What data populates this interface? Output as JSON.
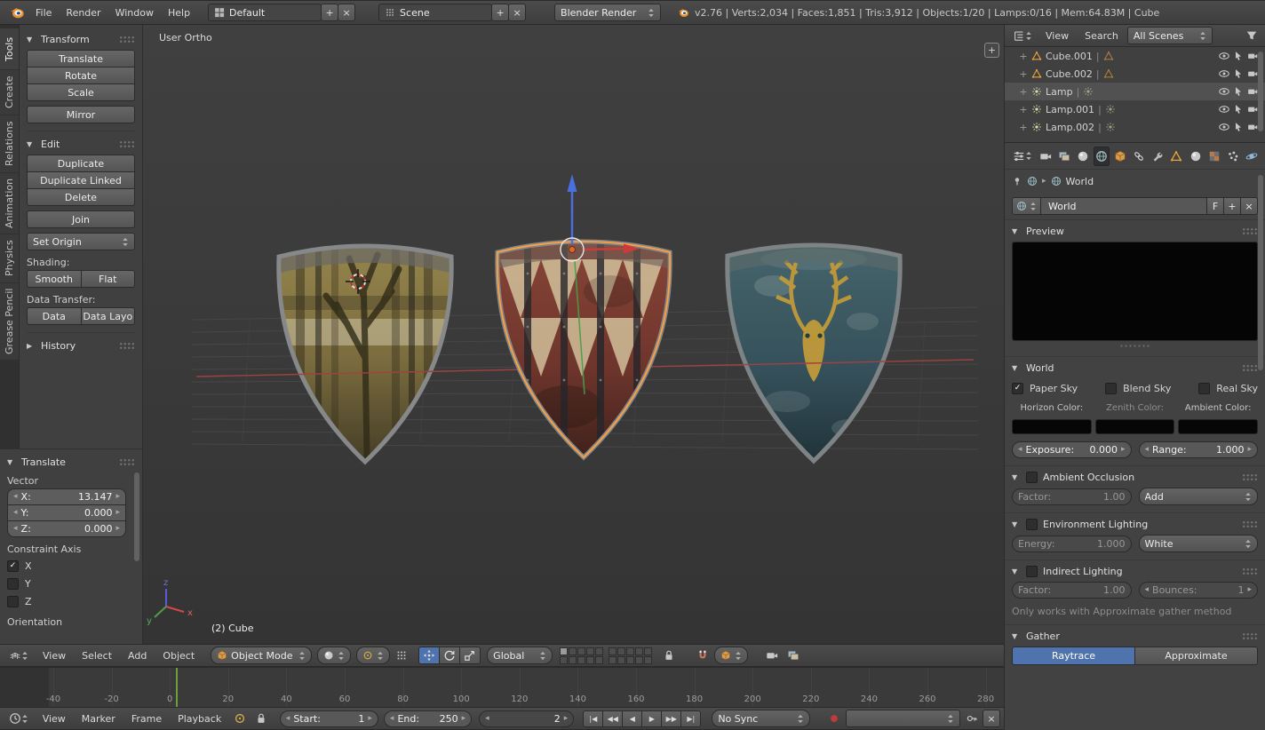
{
  "glyphs": {
    "plus": "+",
    "close": "×",
    "collapse": "▼",
    "expand": "▶",
    "check": "✓",
    "left": "◂",
    "right": "▸",
    "pipe": "|",
    "jump_start": "|◀",
    "prev_key": "◀◀",
    "play_rev": "◀",
    "play": "▶",
    "next_key": "▶▶",
    "jump_end": "▶|"
  },
  "colors": {
    "accent": "#4f73ad",
    "selection_outline": "#ffa040"
  },
  "topbar": {
    "menus": [
      "File",
      "Render",
      "Window",
      "Help"
    ],
    "layout": "Default",
    "scene": "Scene",
    "engine": "Blender Render",
    "stats": "v2.76 | Verts:2,034 | Faces:1,851 | Tris:3,912 | Objects:1/20 | Lamps:0/16 | Mem:64.83M | Cube"
  },
  "tool_tabs": [
    "Tools",
    "Create",
    "Relations",
    "Animation",
    "Physics",
    "Grease Pencil"
  ],
  "tool_shelf": {
    "transform_title": "Transform",
    "translate": "Translate",
    "rotate": "Rotate",
    "scale": "Scale",
    "mirror": "Mirror",
    "edit_title": "Edit",
    "duplicate": "Duplicate",
    "duplicate_linked": "Duplicate Linked",
    "delete": "Delete",
    "join": "Join",
    "set_origin": "Set Origin",
    "shading_label": "Shading:",
    "smooth": "Smooth",
    "flat": "Flat",
    "data_transfer_label": "Data Transfer:",
    "data": "Data",
    "data_layout": "Data Layo",
    "history_title": "History"
  },
  "operator": {
    "title": "Translate",
    "vector_label": "Vector",
    "x_label": "X:",
    "x": "13.147",
    "y_label": "Y:",
    "y": "0.000",
    "z_label": "Z:",
    "z": "0.000",
    "constraint_label": "Constraint Axis",
    "axis_x": "X",
    "axis_y": "Y",
    "axis_z": "Z",
    "orientation_label": "Orientation"
  },
  "viewport": {
    "view_label": "User Ortho",
    "object_label": "(2) Cube",
    "menus": [
      "View",
      "Select",
      "Add",
      "Object"
    ],
    "mode": "Object Mode",
    "orientation": "Global"
  },
  "timeline": {
    "ticks": [
      "-40",
      "-20",
      "0",
      "20",
      "40",
      "60",
      "80",
      "100",
      "120",
      "140",
      "160",
      "180",
      "200",
      "220",
      "240",
      "260",
      "280"
    ],
    "menus": [
      "View",
      "Marker",
      "Frame",
      "Playback"
    ],
    "start_label": "Start:",
    "start": "1",
    "end_label": "End:",
    "end": "250",
    "frame": "2",
    "sync": "No Sync"
  },
  "outliner": {
    "view": "View",
    "search": "Search",
    "scenes": "All Scenes",
    "items": [
      {
        "name": "Cube.001"
      },
      {
        "name": "Cube.002"
      },
      {
        "name": "Lamp"
      },
      {
        "name": "Lamp.001"
      },
      {
        "name": "Lamp.002"
      }
    ]
  },
  "props": {
    "breadcrumb": "World",
    "datablock": "World",
    "fake_user": "F",
    "preview_title": "Preview",
    "world_title": "World",
    "paper_sky": "Paper Sky",
    "blend_sky": "Blend Sky",
    "real_sky": "Real Sky",
    "horizon_label": "Horizon Color:",
    "zenith_label": "Zenith Color:",
    "ambient_label": "Ambient Color:",
    "exposure_label": "Exposure:",
    "exposure": "0.000",
    "range_label": "Range:",
    "range": "1.000",
    "ao_title": "Ambient Occlusion",
    "ao_factor_label": "Factor:",
    "ao_factor": "1.00",
    "ao_blend": "Add",
    "env_title": "Environment Lighting",
    "energy_label": "Energy:",
    "energy": "1.000",
    "env_color": "White",
    "ind_title": "Indirect Lighting",
    "ind_factor_label": "Factor:",
    "ind_factor": "1.00",
    "bounces_label": "Bounces:",
    "bounces": "1",
    "note": "Only works with Approximate gather method",
    "gather_title": "Gather",
    "raytrace": "Raytrace",
    "approximate": "Approximate"
  }
}
